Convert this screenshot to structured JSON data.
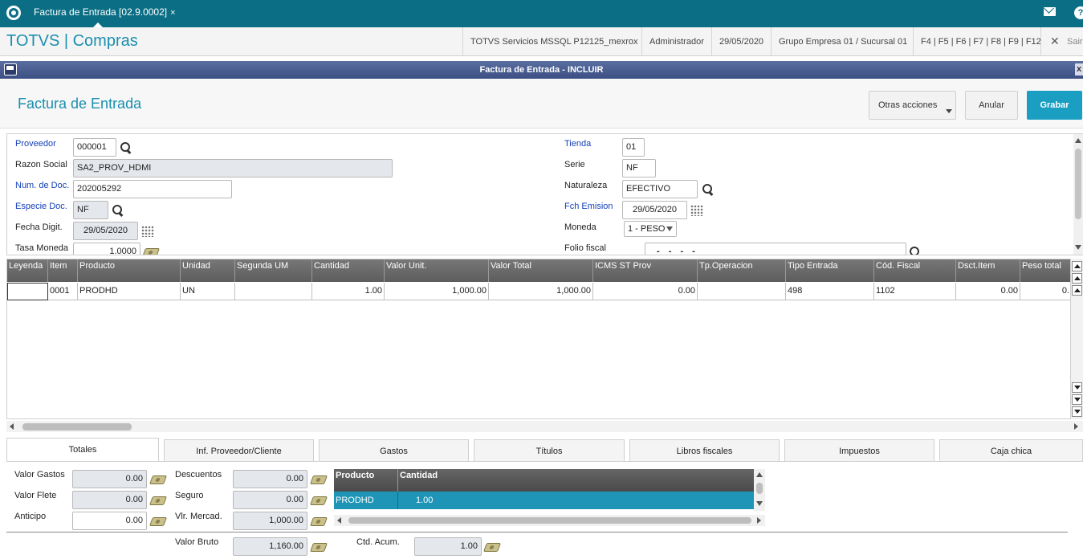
{
  "topbar": {
    "tab_label": "Factura de Entrada [02.9.0002]",
    "tab_close": "×",
    "help": "?"
  },
  "header": {
    "app_title": "TOTVS | Compras",
    "server": "TOTVS Servicios MSSQL P12125_mexrox",
    "user": "Administrador",
    "date": "29/05/2020",
    "company": "Grupo Empresa 01 / Sucursal 01",
    "fkeys": "F4 | F5 | F6 | F7 | F8 | F9 | F12",
    "exit_icon": "✕",
    "exit_label": "Sair"
  },
  "window": {
    "title": "Factura de Entrada - INCLUIR",
    "close": "x"
  },
  "form": {
    "title": "Factura de Entrada",
    "btn_more": "Otras acciones",
    "btn_cancel": "Anular",
    "btn_save": "Grabar"
  },
  "fields": {
    "proveedor_label": "Proveedor",
    "proveedor": "000001",
    "razon_label": "Razon Social",
    "razon": "SA2_PROV_HDMI",
    "numdoc_label": "Num. de Doc.",
    "numdoc": "202005292",
    "especie_label": "Especie Doc.",
    "especie": "NF",
    "fecha_label": "Fecha Digit.",
    "fecha": "29/05/2020",
    "tasa_label": "Tasa Moneda",
    "tasa": "1.0000",
    "tienda_label": "Tienda",
    "tienda": "01",
    "serie_label": "Serie",
    "serie": "NF",
    "naturaleza_label": "Naturaleza",
    "naturaleza": "EFECTIVO",
    "fchemision_label": "Fch Emision",
    "fchemision": "29/05/2020",
    "moneda_label": "Moneda",
    "moneda": "1 - PESO",
    "folio_label": "Folio fiscal",
    "folio": "- - - -"
  },
  "grid": {
    "headers": [
      "Leyenda",
      "Item",
      "Producto",
      "Unidad",
      "Segunda UM",
      "Cantidad",
      "Valor Unit.",
      "Valor Total",
      "ICMS ST Prov",
      "Tp.Operacion",
      "Tipo Entrada",
      "Cód. Fiscal",
      "Dsct.Item",
      "Peso total"
    ],
    "rows": [
      [
        "",
        "0001",
        "PRODHD",
        "UN",
        "",
        "1.00",
        "1,000.00",
        "1,000.00",
        "0.00",
        "",
        "498",
        "1102",
        "0.00",
        "0."
      ]
    ]
  },
  "tabs": [
    "Totales",
    "Inf. Proveedor/Cliente",
    "Gastos",
    "Títulos",
    "Libros fiscales",
    "Impuestos",
    "Caja chica"
  ],
  "totales": {
    "valor_gastos_label": "Valor Gastos",
    "valor_gastos": "0.00",
    "valor_flete_label": "Valor Flete",
    "valor_flete": "0.00",
    "anticipo_label": "Anticipo",
    "anticipo": "0.00",
    "descuentos_label": "Descuentos",
    "descuentos": "0.00",
    "seguro_label": "Seguro",
    "seguro": "0.00",
    "vlr_mercad_label": "Vlr. Mercad.",
    "vlr_mercad": "1,000.00",
    "valor_bruto_label": "Valor Bruto",
    "valor_bruto": "1,160.00",
    "ctd_acum_label": "Ctd. Acum.",
    "ctd_acum": "1.00",
    "mini_headers": [
      "Producto",
      "Cantidad"
    ],
    "mini_row": [
      "PRODHD",
      "1.00"
    ]
  }
}
